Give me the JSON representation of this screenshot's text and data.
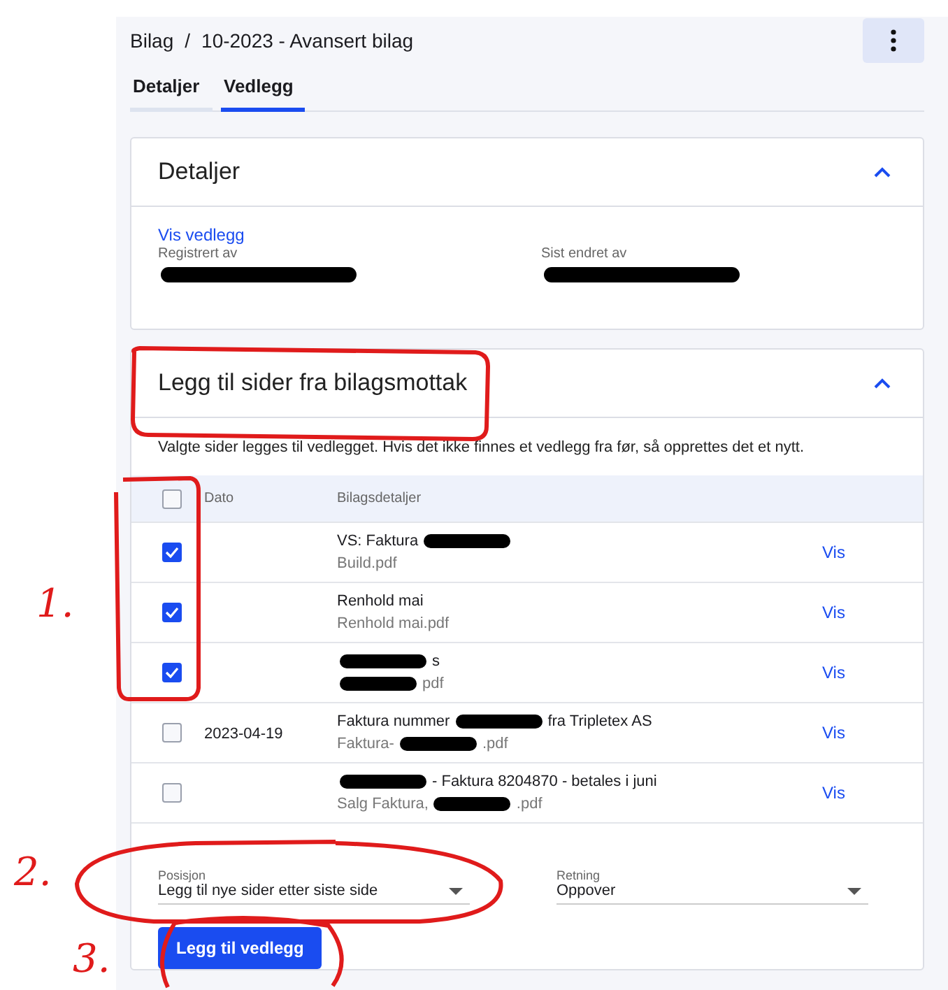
{
  "breadcrumb": {
    "parent": "Bilag",
    "separator": "/",
    "current": "10-2023 - Avansert bilag"
  },
  "tabs": [
    {
      "label": "Detaljer",
      "selected": false
    },
    {
      "label": "Vedlegg",
      "selected": true
    }
  ],
  "details_card": {
    "title": "Detaljer",
    "expanded": true,
    "link": "Vis vedlegg",
    "fields": [
      {
        "label": "Registrert av",
        "value": [
          {
            "redacted": true
          }
        ]
      },
      {
        "label": "Sist endret av",
        "value": [
          {
            "redacted": true
          }
        ]
      }
    ]
  },
  "pages_card": {
    "title": "Legg til sider fra bilagsmottak",
    "expanded": true,
    "description": "Valgte sider legges til vedlegget. Hvis det ikke finnes et vedlegg fra før, så opprettes det et nytt.",
    "table": {
      "select_all": false,
      "columns": [
        "Dato",
        "Bilagsdetaljer"
      ],
      "rows": [
        {
          "selected": true,
          "date": "",
          "title": [
            {
              "text": "VS: Faktura"
            },
            {
              "redacted": true
            }
          ],
          "file": [
            {
              "text": "Build.pdf"
            }
          ],
          "action": "Vis"
        },
        {
          "selected": true,
          "date": "",
          "title": [
            {
              "text": "Renhold mai"
            }
          ],
          "file": [
            {
              "text": "Renhold mai.pdf"
            }
          ],
          "action": "Vis"
        },
        {
          "selected": true,
          "date": "",
          "title": [
            {
              "redacted": true
            },
            {
              "text": "s"
            }
          ],
          "file": [
            {
              "redacted": true
            },
            {
              "text": "pdf"
            }
          ],
          "action": "Vis"
        },
        {
          "selected": false,
          "date": "2023-04-19",
          "title": [
            {
              "text": "Faktura nummer"
            },
            {
              "redacted": true
            },
            {
              "text": "fra Tripletex AS"
            }
          ],
          "file": [
            {
              "text": "Faktura-"
            },
            {
              "redacted": true
            },
            {
              "text": ".pdf"
            }
          ],
          "action": "Vis"
        },
        {
          "selected": false,
          "date": "",
          "title": [
            {
              "redacted": true
            },
            {
              "text": "- Faktura 8204870 - betales i juni"
            }
          ],
          "file": [
            {
              "text": "Salg Faktura,"
            },
            {
              "redacted": true
            },
            {
              "text": ".pdf"
            }
          ],
          "action": "Vis"
        }
      ]
    },
    "selects": [
      {
        "label": "Posisjon",
        "value": "Legg til nye sider etter siste side"
      },
      {
        "label": "Retning",
        "value": "Oppover"
      }
    ],
    "button": "Legg til vedlegg"
  },
  "annotations": [
    {
      "label": "1."
    },
    {
      "label": "2."
    },
    {
      "label": "3."
    }
  ]
}
